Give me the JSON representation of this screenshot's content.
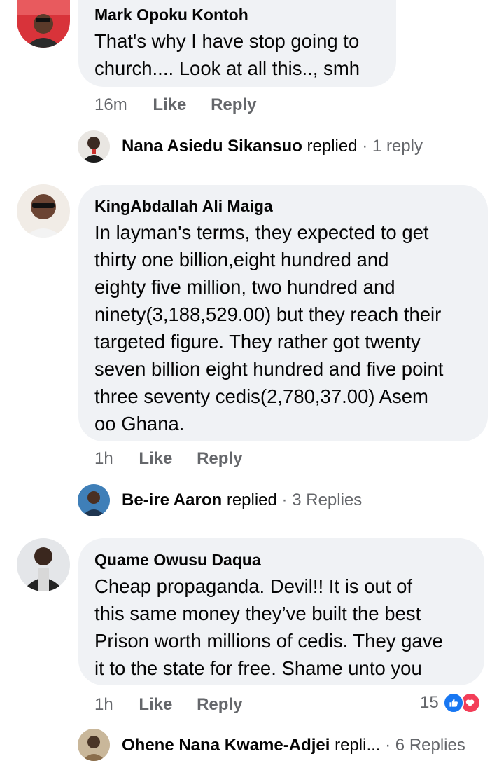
{
  "comments": [
    {
      "author": "Mark Opoku Kontoh",
      "lines": [
        "That's why I have stop going to",
        "church.... Look at all this.., smh"
      ],
      "time": "16m",
      "like_label": "Like",
      "reply_label": "Reply",
      "avatar_icon": "avatar-photo-icon",
      "replies_row": {
        "name": "Nana Asiedu Sikansuo",
        "verb": "replied",
        "sep": "·",
        "count": "1 reply"
      }
    },
    {
      "author": "KingAbdallah Ali Maiga",
      "lines": [
        "In layman's terms, they expected to get",
        "thirty one billion,eight hundred and",
        "eighty five million, two hundred and",
        "ninety(3,188,529.00) but they reach their",
        "targeted figure. They rather got twenty",
        "seven billion eight hundred and five point",
        "three seventy cedis(2,780,37.00) Asem",
        "oo Ghana."
      ],
      "time": "1h",
      "like_label": "Like",
      "reply_label": "Reply",
      "avatar_icon": "avatar-photo-icon",
      "replies_row": {
        "name": "Be-ire Aaron",
        "verb": "replied",
        "sep": "·",
        "count": "3 Replies"
      }
    },
    {
      "author": "Quame Owusu Daqua",
      "lines": [
        "Cheap propaganda. Devil!! It is out of",
        "this same money they’ve built the best",
        "Prison worth millions of cedis. They gave",
        "it to the state for free. Shame unto you"
      ],
      "time": "1h",
      "like_label": "Like",
      "reply_label": "Reply",
      "avatar_icon": "avatar-photo-icon",
      "reactions": {
        "count": "15",
        "icons": [
          "like-reaction-icon",
          "love-reaction-icon"
        ]
      },
      "replies_row": {
        "name": "Ohene Nana Kwame-Adjei",
        "verb": "repli...",
        "sep": "·",
        "count": "6 Replies"
      }
    }
  ],
  "colors": {
    "bubble": "#f0f2f5",
    "secondary_text": "#65676b",
    "like_blue": "#1877f2",
    "love_red": "#f33e58"
  }
}
